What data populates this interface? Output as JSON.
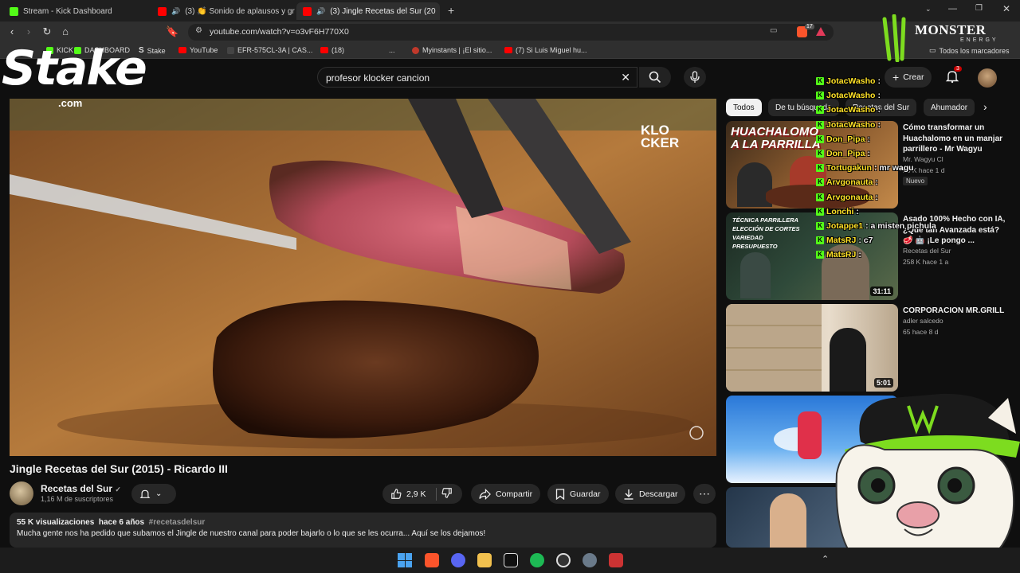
{
  "browser": {
    "tabs": [
      {
        "label": "Stream - Kick Dashboard",
        "color": "#53fc18"
      },
      {
        "label": "(3) 👏 Sonido de aplausos y grit",
        "color": "#ff0000"
      },
      {
        "label": "(3) Jingle Recetas del Sur (20",
        "color": "#ff0000",
        "active": true
      }
    ],
    "url": "youtube.com/watch?v=o3vF6H770X0",
    "bookmarks": [
      "KICK",
      "DASHBOARD",
      "Stake",
      "YouTube",
      "EFR-575CL-3A | CAS...",
      "(18)",
      "...",
      "Myinstants | ¡El sitio...",
      "(7) Si Luis Miguel hu...",
      "Todos los marcadores"
    ],
    "brave_badge": "17"
  },
  "youtube": {
    "search_query": "profesor klocker cancion",
    "create_label": "Crear",
    "notifications": "3",
    "video": {
      "watermark_top": "KLO CKER",
      "watermark_sub": "PROFESOR",
      "title": "Jingle Recetas del Sur (2015) - Ricardo III",
      "channel": "Recetas del Sur",
      "subscribers": "1,16 M de suscriptores",
      "likes": "2,9 K",
      "share_label": "Compartir",
      "save_label": "Guardar",
      "download_label": "Descargar",
      "views": "55 K visualizaciones",
      "age": "hace 6 años",
      "hashtag": "#recetasdelsur",
      "description": "Mucha gente nos ha pedido que subamos el Jingle de nuestro canal para poder bajarlo o lo que se les ocurra... Aquí se los dejamos!"
    },
    "chips": [
      "Todos",
      "De tu búsqueda",
      "Recetas del Sur",
      "Ahumador"
    ],
    "recommendations": [
      {
        "title": "Cómo transformar un Huachalomo en un manjar parrillero - Mr Wagyu",
        "channel": "Mr. Wagyu Cl",
        "meta": "25 K  hace 1 d",
        "badge": "Nuevo",
        "thumb_text": "HUACHALOMO A LA PARRILLA",
        "duration": ""
      },
      {
        "title": "Asado 100% Hecho con IA, ¿Qué tan Avanzada está? 🥩 🤖 ¡Le pongo ...",
        "channel": "Recetas del Sur",
        "meta": "258 K  hace 1 a",
        "badge": "",
        "thumb_text": "TÉCNICA PARRILLERA ELECCIÓN DE CORTES VARIEDAD PRESUPUESTO",
        "duration": "31:11"
      },
      {
        "title": "CORPORACION MR.GRILL",
        "channel": "adler salcedo",
        "meta": "65  hace 8 d",
        "badge": "",
        "thumb_text": "",
        "duration": "5:01"
      }
    ]
  },
  "chat": [
    {
      "user": "JotacWasho",
      "msg": ":"
    },
    {
      "user": "JotacWasho",
      "msg": ":"
    },
    {
      "user": "JotacWasho",
      "msg": ":"
    },
    {
      "user": "JotacWasho",
      "msg": ":"
    },
    {
      "user": "Don_Pipa",
      "msg": ":"
    },
    {
      "user": "Don_Pipa",
      "msg": ":"
    },
    {
      "user": "Tortugakun",
      "msg": ": mr wagu"
    },
    {
      "user": "Arvgonauta",
      "msg": ":"
    },
    {
      "user": "Arvgonauta",
      "msg": ":"
    },
    {
      "user": "Lonchi",
      "msg": ":"
    },
    {
      "user": "Jotappe1",
      "msg": ": a misten pichula"
    },
    {
      "user": "MatsRJ",
      "msg": ": c7"
    },
    {
      "user": "MatsRJ",
      "msg": ":"
    }
  ],
  "overlays": {
    "stake_logo": "Stake",
    "stake_com": ".com",
    "monster": "MONSTER",
    "energy": "ENERGY"
  }
}
